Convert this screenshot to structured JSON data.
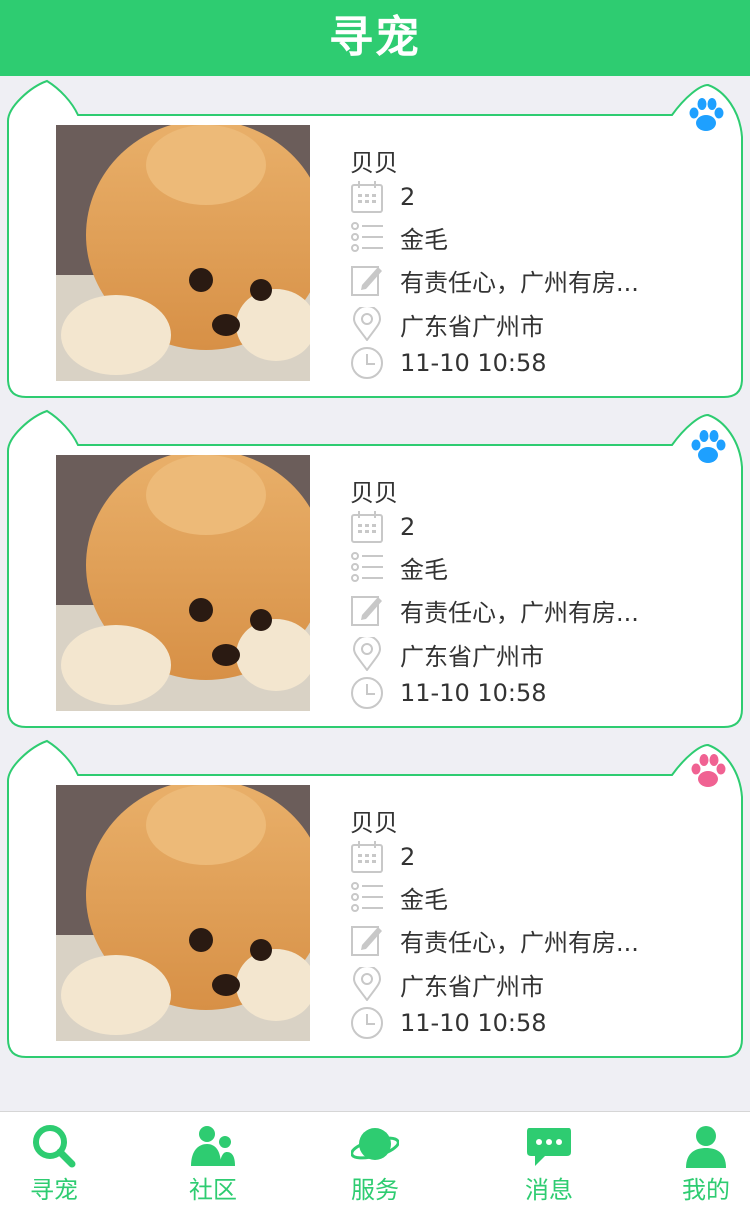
{
  "header": {
    "title": "寻宠"
  },
  "pets": [
    {
      "name": "贝贝",
      "age": "2",
      "breed": "金毛",
      "description": "有责任心，广州有房...",
      "location": "广东省广州市",
      "time": "11-10 10:58",
      "paw_color": "#1ea0ff"
    },
    {
      "name": "贝贝",
      "age": "2",
      "breed": "金毛",
      "description": "有责任心，广州有房...",
      "location": "广东省广州市",
      "time": "11-10 10:58",
      "paw_color": "#1ea0ff"
    },
    {
      "name": "贝贝",
      "age": "2",
      "breed": "金毛",
      "description": "有责任心，广州有房...",
      "location": "广东省广州市",
      "time": "11-10 10:58",
      "paw_color": "#f06292"
    }
  ],
  "tabbar": {
    "items": [
      {
        "label": "寻宠",
        "icon": "search-icon"
      },
      {
        "label": "社区",
        "icon": "community-icon"
      },
      {
        "label": "服务",
        "icon": "planet-icon"
      },
      {
        "label": "消息",
        "icon": "message-icon"
      },
      {
        "label": "我的",
        "icon": "profile-icon"
      }
    ]
  },
  "colors": {
    "accent": "#2ecc71",
    "background": "#efeff4"
  }
}
